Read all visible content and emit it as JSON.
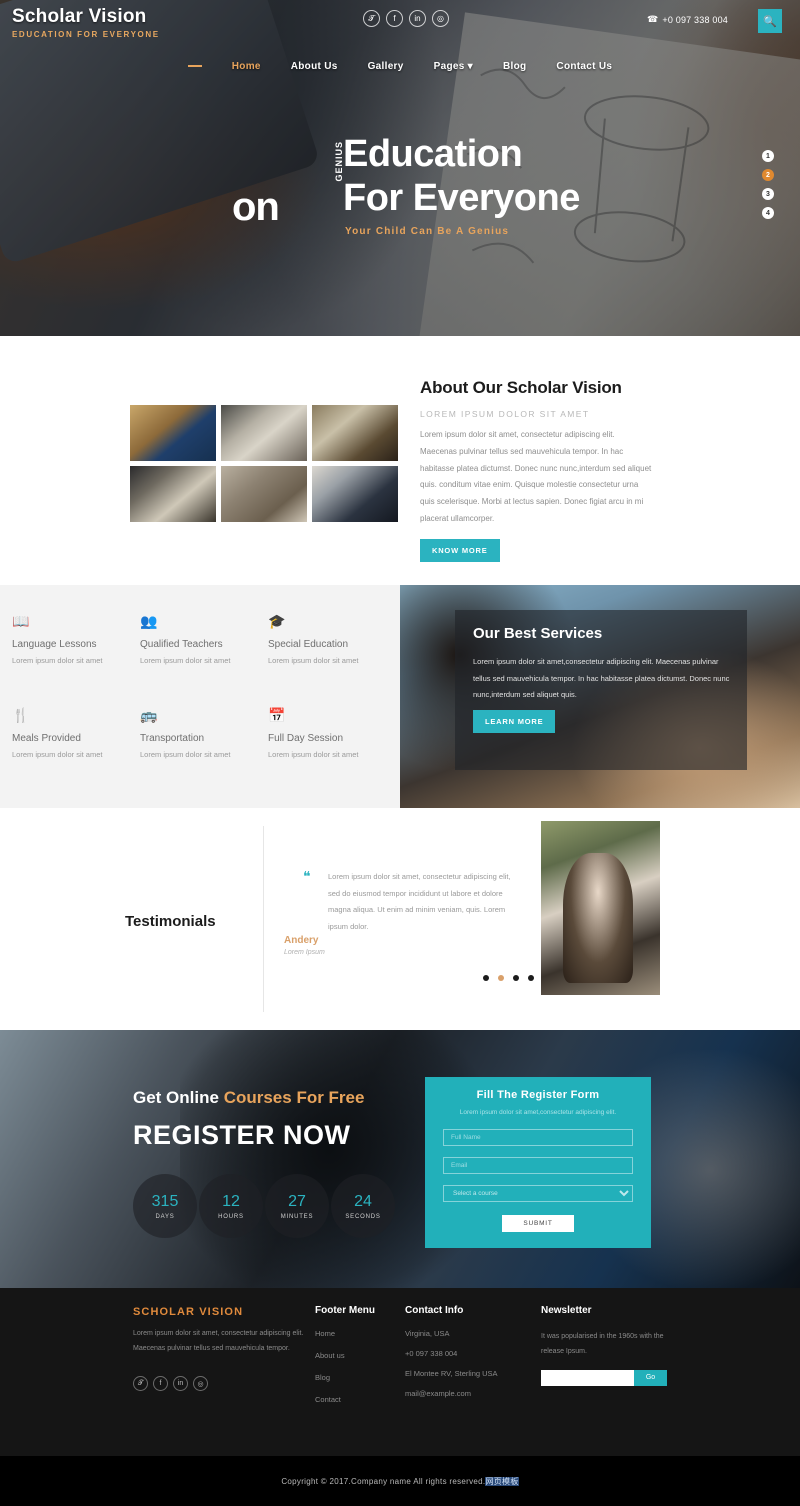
{
  "header": {
    "brand_name": "Scholar Vision",
    "brand_tagline": "Education For Everyone",
    "phone": "+0 097 338 004",
    "social": [
      {
        "name": "twitter-icon",
        "glyph": "𝓣"
      },
      {
        "name": "facebook-icon",
        "glyph": "f"
      },
      {
        "name": "linkedin-icon",
        "glyph": "in"
      },
      {
        "name": "dribbble-icon",
        "glyph": "◎"
      }
    ],
    "search_icon": "search-icon",
    "nav": [
      {
        "label": "Home",
        "active": true
      },
      {
        "label": "About Us",
        "active": false
      },
      {
        "label": "Gallery",
        "active": false
      },
      {
        "label": "Pages",
        "active": false,
        "caret": "▾"
      },
      {
        "label": "Blog",
        "active": false
      },
      {
        "label": "Contact Us",
        "active": false
      }
    ]
  },
  "hero": {
    "prev_word": "on",
    "vertical_label": "GENIUS",
    "line1": "Education",
    "line2": "For Everyone",
    "subtitle": "Your Child Can Be A Genius",
    "slide_dots": [
      {
        "label": "1",
        "active": false
      },
      {
        "label": "2",
        "active": true
      },
      {
        "label": "3",
        "active": false
      },
      {
        "label": "4",
        "active": false
      }
    ]
  },
  "about": {
    "title": "About Our Scholar Vision",
    "subtitle": "LOREM IPSUM DOLOR SIT AMET",
    "body": "Lorem ipsum dolor sit amet, consectetur adipiscing elit. Maecenas pulvinar tellus sed mauvehicula tempor. In hac habitasse platea dictumst. Donec nunc nunc,interdum sed aliquet quis. conditum vitae enim. Quisque molestie consectetur urna quis scelerisque. Morbi at lectus sapien. Donec figiat arcu in mi placerat ullamcorper.",
    "button": "KNOW MORE",
    "gallery_alt": [
      "graduate-photo",
      "students-library-photo",
      "classroom-photo",
      "study-desk-photo",
      "bookshelves-photo",
      "graduation-cap-photo"
    ]
  },
  "services": {
    "items": [
      {
        "icon": "book-icon",
        "glyph": "📖",
        "title": "Language Lessons",
        "desc": "Lorem ipsum dolor sit amet"
      },
      {
        "icon": "users-icon",
        "glyph": "👥",
        "title": "Qualified Teachers",
        "desc": "Lorem ipsum dolor sit amet"
      },
      {
        "icon": "graduation-cap-icon",
        "glyph": "🎓",
        "title": "Special Education",
        "desc": "Lorem ipsum dolor sit amet"
      },
      {
        "icon": "utensils-icon",
        "glyph": "🍴",
        "title": "Meals Provided",
        "desc": "Lorem ipsum dolor sit amet"
      },
      {
        "icon": "bus-icon",
        "glyph": "🚌",
        "title": "Transportation",
        "desc": "Lorem ipsum dolor sit amet"
      },
      {
        "icon": "calendar-check-icon",
        "glyph": "📅",
        "title": "Full Day Session",
        "desc": "Lorem ipsum dolor sit amet"
      }
    ],
    "panel": {
      "title": "Our Best Services",
      "body": "Lorem ipsum dolor sit amet,consectetur adipiscing elit. Maecenas pulvinar tellus sed mauvehicula tempor. In hac habitasse platea dictumst. Donec nunc nunc,interdum sed aliquet quis.",
      "button": "LEARN MORE"
    }
  },
  "testimonials": {
    "title": "Testimonials",
    "quote_icon": "quote-icon",
    "body": "Lorem ipsum dolor sit amet, consectetur adipiscing elit, sed do eiusmod tempor incididunt ut labore et dolore magna aliqua. Ut enim ad minim veniam, quis. Lorem ipsum dolor.",
    "author": "Andery",
    "author_role": "Lorem Ipsum",
    "dots": [
      {
        "active": false
      },
      {
        "active": true
      },
      {
        "active": false
      },
      {
        "active": false
      }
    ]
  },
  "register": {
    "eyebrow_part1": "Get Online ",
    "eyebrow_highlight": "Courses",
    "eyebrow_part2": " For Free",
    "headline": "REGISTER NOW",
    "countdown": [
      {
        "value": "315",
        "label": "DAYS"
      },
      {
        "value": "12",
        "label": "HOURS"
      },
      {
        "value": "27",
        "label": "MINUTES"
      },
      {
        "value": "24",
        "label": "SECONDS"
      }
    ],
    "form": {
      "title": "Fill The Register Form",
      "subtitle": "Lorem ipsum dolor sit amet,consectetur adipiscing elit.",
      "name_placeholder": "Full Name",
      "email_placeholder": "Email",
      "select_value": "Select a course",
      "submit": "SUBMIT"
    }
  },
  "footer": {
    "brand": "SCHOLAR VISION",
    "about": "Lorem ipsum dolor sit amet, consectetur adipiscing elit. Maecenas pulvinar tellus sed mauvehicula tempor.",
    "social": [
      {
        "name": "twitter-icon",
        "glyph": "𝓣"
      },
      {
        "name": "facebook-icon",
        "glyph": "f"
      },
      {
        "name": "linkedin-icon",
        "glyph": "in"
      },
      {
        "name": "dribbble-icon",
        "glyph": "◎"
      }
    ],
    "menu_title": "Footer Menu",
    "menu": [
      {
        "label": "Home"
      },
      {
        "label": "About us"
      },
      {
        "label": "Blog"
      },
      {
        "label": "Contact"
      }
    ],
    "contact_title": "Contact Info",
    "contact": [
      {
        "line": "Virginia, USA"
      },
      {
        "line": "+0 097 338 004"
      },
      {
        "line": "El Montee RV, Sterling USA"
      },
      {
        "line": "mail@example.com"
      }
    ],
    "newsletter_title": "Newsletter",
    "newsletter_text": "It was popularised in the 1960s with the release Ipsum.",
    "newsletter_placeholder": "",
    "newsletter_button": "Go"
  },
  "copyright": {
    "text": "Copyright © 2017.Company name All rights reserved.",
    "selected": "网页模板"
  }
}
